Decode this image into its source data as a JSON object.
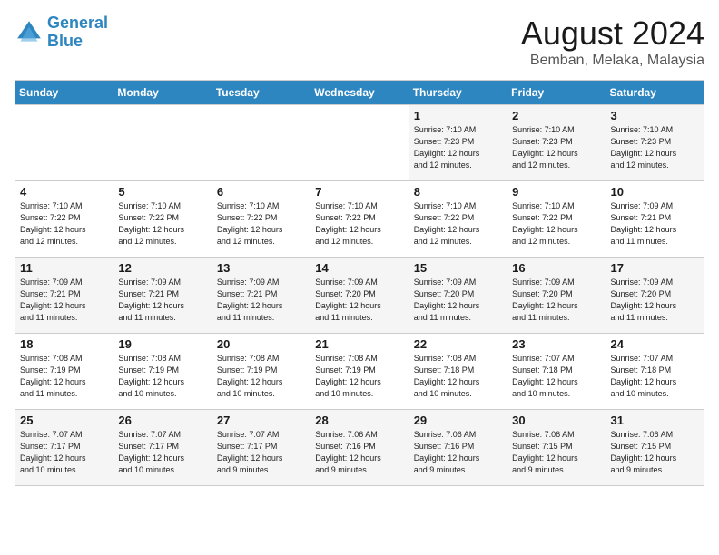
{
  "logo": {
    "line1": "General",
    "line2": "Blue"
  },
  "title": "August 2024",
  "subtitle": "Bemban, Melaka, Malaysia",
  "days_of_week": [
    "Sunday",
    "Monday",
    "Tuesday",
    "Wednesday",
    "Thursday",
    "Friday",
    "Saturday"
  ],
  "weeks": [
    [
      {
        "day": "",
        "info": ""
      },
      {
        "day": "",
        "info": ""
      },
      {
        "day": "",
        "info": ""
      },
      {
        "day": "",
        "info": ""
      },
      {
        "day": "1",
        "info": "Sunrise: 7:10 AM\nSunset: 7:23 PM\nDaylight: 12 hours\nand 12 minutes."
      },
      {
        "day": "2",
        "info": "Sunrise: 7:10 AM\nSunset: 7:23 PM\nDaylight: 12 hours\nand 12 minutes."
      },
      {
        "day": "3",
        "info": "Sunrise: 7:10 AM\nSunset: 7:23 PM\nDaylight: 12 hours\nand 12 minutes."
      }
    ],
    [
      {
        "day": "4",
        "info": "Sunrise: 7:10 AM\nSunset: 7:22 PM\nDaylight: 12 hours\nand 12 minutes."
      },
      {
        "day": "5",
        "info": "Sunrise: 7:10 AM\nSunset: 7:22 PM\nDaylight: 12 hours\nand 12 minutes."
      },
      {
        "day": "6",
        "info": "Sunrise: 7:10 AM\nSunset: 7:22 PM\nDaylight: 12 hours\nand 12 minutes."
      },
      {
        "day": "7",
        "info": "Sunrise: 7:10 AM\nSunset: 7:22 PM\nDaylight: 12 hours\nand 12 minutes."
      },
      {
        "day": "8",
        "info": "Sunrise: 7:10 AM\nSunset: 7:22 PM\nDaylight: 12 hours\nand 12 minutes."
      },
      {
        "day": "9",
        "info": "Sunrise: 7:10 AM\nSunset: 7:22 PM\nDaylight: 12 hours\nand 12 minutes."
      },
      {
        "day": "10",
        "info": "Sunrise: 7:09 AM\nSunset: 7:21 PM\nDaylight: 12 hours\nand 11 minutes."
      }
    ],
    [
      {
        "day": "11",
        "info": "Sunrise: 7:09 AM\nSunset: 7:21 PM\nDaylight: 12 hours\nand 11 minutes."
      },
      {
        "day": "12",
        "info": "Sunrise: 7:09 AM\nSunset: 7:21 PM\nDaylight: 12 hours\nand 11 minutes."
      },
      {
        "day": "13",
        "info": "Sunrise: 7:09 AM\nSunset: 7:21 PM\nDaylight: 12 hours\nand 11 minutes."
      },
      {
        "day": "14",
        "info": "Sunrise: 7:09 AM\nSunset: 7:20 PM\nDaylight: 12 hours\nand 11 minutes."
      },
      {
        "day": "15",
        "info": "Sunrise: 7:09 AM\nSunset: 7:20 PM\nDaylight: 12 hours\nand 11 minutes."
      },
      {
        "day": "16",
        "info": "Sunrise: 7:09 AM\nSunset: 7:20 PM\nDaylight: 12 hours\nand 11 minutes."
      },
      {
        "day": "17",
        "info": "Sunrise: 7:09 AM\nSunset: 7:20 PM\nDaylight: 12 hours\nand 11 minutes."
      }
    ],
    [
      {
        "day": "18",
        "info": "Sunrise: 7:08 AM\nSunset: 7:19 PM\nDaylight: 12 hours\nand 11 minutes."
      },
      {
        "day": "19",
        "info": "Sunrise: 7:08 AM\nSunset: 7:19 PM\nDaylight: 12 hours\nand 10 minutes."
      },
      {
        "day": "20",
        "info": "Sunrise: 7:08 AM\nSunset: 7:19 PM\nDaylight: 12 hours\nand 10 minutes."
      },
      {
        "day": "21",
        "info": "Sunrise: 7:08 AM\nSunset: 7:19 PM\nDaylight: 12 hours\nand 10 minutes."
      },
      {
        "day": "22",
        "info": "Sunrise: 7:08 AM\nSunset: 7:18 PM\nDaylight: 12 hours\nand 10 minutes."
      },
      {
        "day": "23",
        "info": "Sunrise: 7:07 AM\nSunset: 7:18 PM\nDaylight: 12 hours\nand 10 minutes."
      },
      {
        "day": "24",
        "info": "Sunrise: 7:07 AM\nSunset: 7:18 PM\nDaylight: 12 hours\nand 10 minutes."
      }
    ],
    [
      {
        "day": "25",
        "info": "Sunrise: 7:07 AM\nSunset: 7:17 PM\nDaylight: 12 hours\nand 10 minutes."
      },
      {
        "day": "26",
        "info": "Sunrise: 7:07 AM\nSunset: 7:17 PM\nDaylight: 12 hours\nand 10 minutes."
      },
      {
        "day": "27",
        "info": "Sunrise: 7:07 AM\nSunset: 7:17 PM\nDaylight: 12 hours\nand 9 minutes."
      },
      {
        "day": "28",
        "info": "Sunrise: 7:06 AM\nSunset: 7:16 PM\nDaylight: 12 hours\nand 9 minutes."
      },
      {
        "day": "29",
        "info": "Sunrise: 7:06 AM\nSunset: 7:16 PM\nDaylight: 12 hours\nand 9 minutes."
      },
      {
        "day": "30",
        "info": "Sunrise: 7:06 AM\nSunset: 7:15 PM\nDaylight: 12 hours\nand 9 minutes."
      },
      {
        "day": "31",
        "info": "Sunrise: 7:06 AM\nSunset: 7:15 PM\nDaylight: 12 hours\nand 9 minutes."
      }
    ]
  ]
}
